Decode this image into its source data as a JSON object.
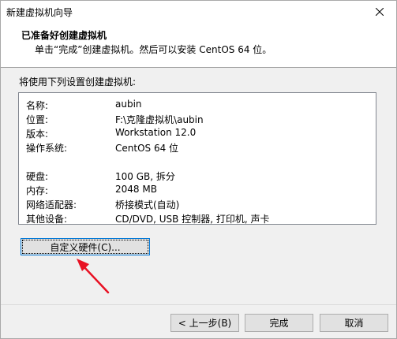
{
  "window": {
    "title": "新建虚拟机向导"
  },
  "header": {
    "title": "已准备好创建虚拟机",
    "subtitle": "单击“完成”创建虚拟机。然后可以安装 CentOS 64 位。"
  },
  "main": {
    "intro": "将使用下列设置创建虚拟机:",
    "summary": [
      {
        "key": "名称:",
        "value": "aubin"
      },
      {
        "key": "位置:",
        "value": "F:\\克隆虚拟机\\aubin"
      },
      {
        "key": "版本:",
        "value": "Workstation 12.0"
      },
      {
        "key": "操作系统:",
        "value": "CentOS 64 位"
      },
      {
        "key": "硬盘:",
        "value": "100 GB, 拆分"
      },
      {
        "key": "内存:",
        "value": "2048 MB"
      },
      {
        "key": "网络适配器:",
        "value": "桥接模式(自动)"
      },
      {
        "key": "其他设备:",
        "value": "CD/DVD, USB 控制器, 打印机, 声卡"
      }
    ],
    "customize_button": "自定义硬件(C)..."
  },
  "footer": {
    "back_button": "< 上一步(B)",
    "finish_button": "完成",
    "cancel_button": "取消"
  },
  "colors": {
    "accent": "#0078d7",
    "annotation_arrow": "#e81123"
  },
  "icons": {
    "close": "close-icon",
    "annotation": "red-arrow-annotation"
  }
}
